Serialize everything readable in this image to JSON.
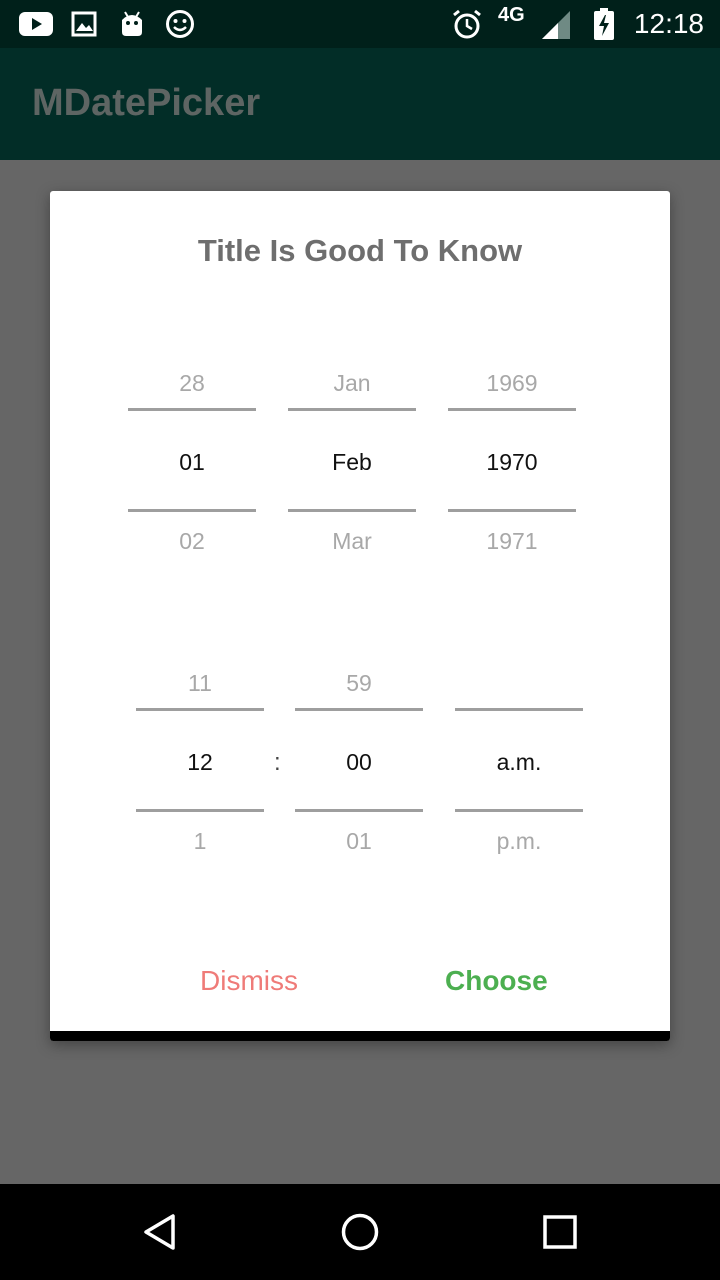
{
  "status_bar": {
    "network": "4G",
    "time": "12:18",
    "icons": [
      "youtube-icon",
      "image-icon",
      "android-icon",
      "smiley-icon",
      "alarm-icon",
      "signal-icon",
      "battery-charging-icon"
    ]
  },
  "app_bar": {
    "title": "MDatePicker"
  },
  "dialog": {
    "title": "Title Is Good To Know",
    "date": {
      "day": {
        "prev": "28",
        "selected": "01",
        "next": "02"
      },
      "month": {
        "prev": "Jan",
        "selected": "Feb",
        "next": "Mar"
      },
      "year": {
        "prev": "1969",
        "selected": "1970",
        "next": "1971"
      }
    },
    "time": {
      "hour": {
        "prev": "11",
        "selected": "12",
        "next": "1"
      },
      "separator": ":",
      "minute": {
        "prev": "59",
        "selected": "00",
        "next": "01"
      },
      "ampm": {
        "prev": "",
        "selected": "a.m.",
        "next": "p.m."
      }
    },
    "buttons": {
      "dismiss": "Dismiss",
      "choose": "Choose"
    }
  },
  "nav_bar": {
    "icons": [
      "back-icon",
      "home-icon",
      "recents-icon"
    ]
  },
  "colors": {
    "status_bar": "#00201A",
    "app_bar": "#022D27",
    "scrim": "#666666",
    "dismiss": "#EF7B78",
    "choose": "#4CAF50"
  }
}
